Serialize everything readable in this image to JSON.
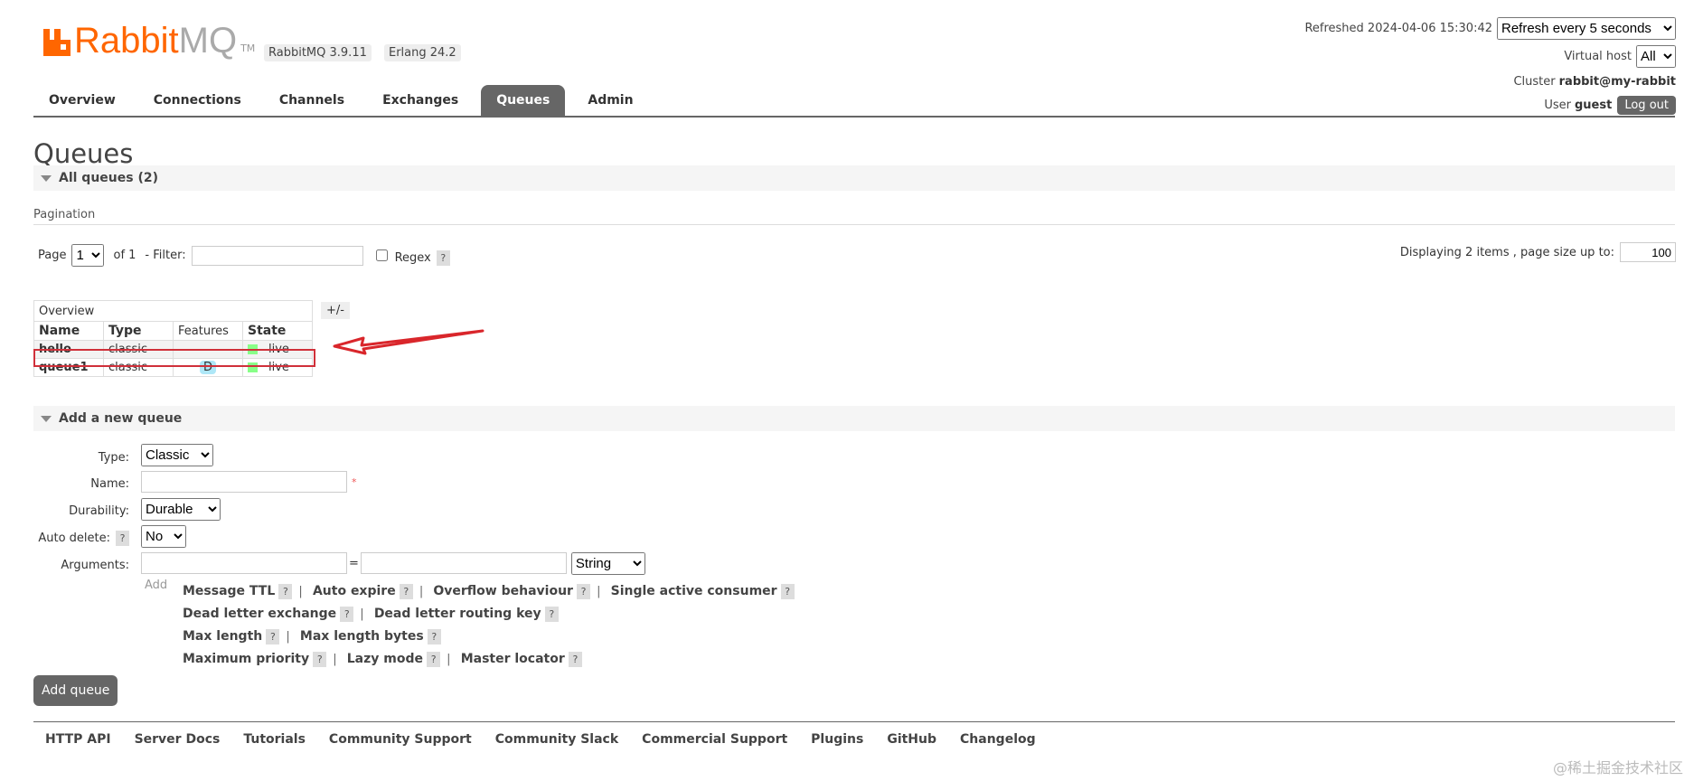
{
  "header": {
    "logo_main": "Rabbit",
    "logo_mq": "MQ",
    "logo_tm": "TM",
    "version_badge": "RabbitMQ 3.9.11",
    "erlang_badge": "Erlang 24.2",
    "refreshed_label": "Refreshed 2024-04-06 15:30:42",
    "refresh_select": "Refresh every 5 seconds",
    "vhost_label": "Virtual host",
    "vhost_select": "All",
    "cluster_label": "Cluster",
    "cluster_value": "rabbit@my-rabbit",
    "user_label": "User",
    "user_value": "guest",
    "logout_label": "Log out"
  },
  "nav": {
    "tabs": [
      "Overview",
      "Connections",
      "Channels",
      "Exchanges",
      "Queues",
      "Admin"
    ],
    "active": "Queues"
  },
  "page": {
    "title": "Queues",
    "all_queues": "All queues (2)",
    "pagination_label": "Pagination",
    "page_label": "Page",
    "page_value": "1",
    "of_label": "of 1",
    "filter_label": "- Filter:",
    "filter_value": "",
    "regex_label": "Regex",
    "help": "?",
    "displaying": "Displaying 2 items , page size up to:",
    "page_size": "100"
  },
  "table": {
    "group_header": "Overview",
    "plus_minus": "+/-",
    "columns": [
      "Name",
      "Type",
      "Features",
      "State"
    ],
    "rows": [
      {
        "name": "hello",
        "type": "classic",
        "features": "",
        "state": "live"
      },
      {
        "name": "queue1",
        "type": "classic",
        "features": "D",
        "state": "live"
      }
    ]
  },
  "add_queue": {
    "section_title": "Add a new queue",
    "type_label": "Type:",
    "type_value": "Classic",
    "name_label": "Name:",
    "name_value": "",
    "required_mark": "*",
    "durability_label": "Durability:",
    "durability_value": "Durable",
    "autodelete_label": "Auto delete:",
    "autodelete_value": "No",
    "arguments_label": "Arguments:",
    "equals": "=",
    "arg_type_value": "String",
    "add_label": "Add",
    "arg_links": [
      [
        "Message TTL",
        "Auto expire",
        "Overflow behaviour",
        "Single active consumer"
      ],
      [
        "Dead letter exchange",
        "Dead letter routing key"
      ],
      [
        "Max length",
        "Max length bytes"
      ],
      [
        "Maximum priority",
        "Lazy mode",
        "Master locator"
      ]
    ],
    "sep": "|",
    "add_button": "Add queue"
  },
  "footer": {
    "links": [
      "HTTP API",
      "Server Docs",
      "Tutorials",
      "Community Support",
      "Community Slack",
      "Commercial Support",
      "Plugins",
      "GitHub",
      "Changelog"
    ]
  },
  "watermark": "@稀土掘金技术社区",
  "colors": {
    "brand": "#ff6600",
    "highlight": "#d0303a",
    "tab_active": "#666666"
  }
}
